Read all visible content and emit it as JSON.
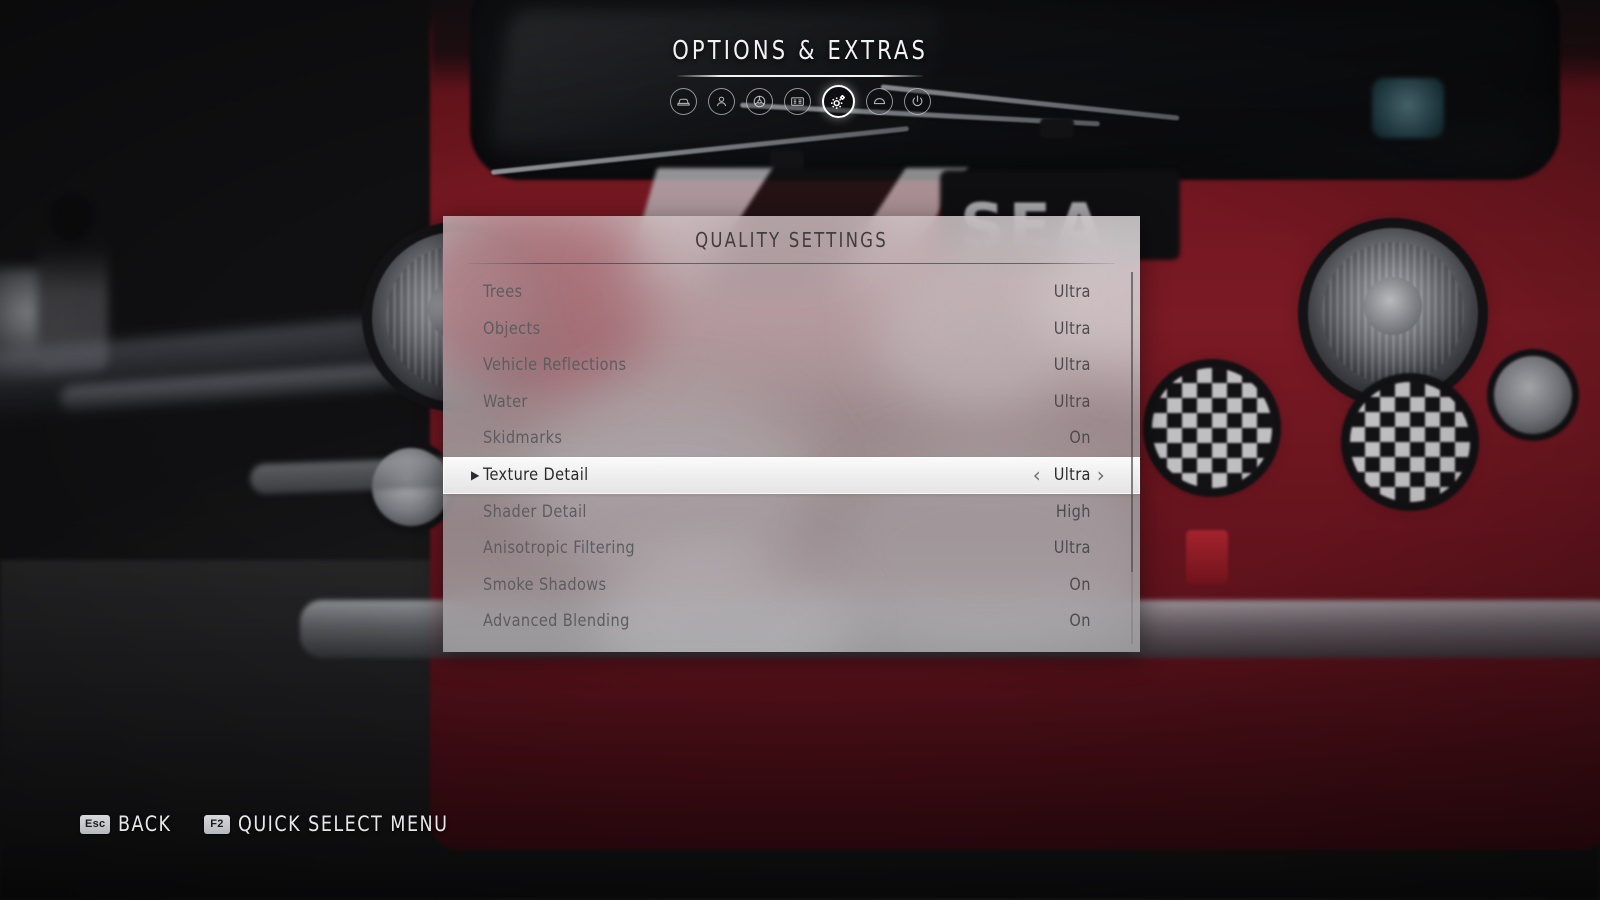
{
  "header": {
    "title": "OPTIONS & EXTRAS",
    "nav_icons": [
      {
        "name": "car-icon",
        "selected": false
      },
      {
        "name": "driver-icon",
        "selected": false
      },
      {
        "name": "wheel-icon",
        "selected": false
      },
      {
        "name": "display-icon",
        "selected": false
      },
      {
        "name": "gear-icon",
        "selected": true
      },
      {
        "name": "audio-icon",
        "selected": false
      },
      {
        "name": "power-icon",
        "selected": false
      }
    ]
  },
  "panel": {
    "title": "QUALITY SETTINGS",
    "selected_index": 5,
    "left_chevron": "‹",
    "right_chevron": "›",
    "selection_marker": "▶",
    "rows": [
      {
        "label": "Trees",
        "value": "Ultra"
      },
      {
        "label": "Objects",
        "value": "Ultra"
      },
      {
        "label": "Vehicle Reflections",
        "value": "Ultra"
      },
      {
        "label": "Water",
        "value": "Ultra"
      },
      {
        "label": "Skidmarks",
        "value": "On"
      },
      {
        "label": "Texture Detail",
        "value": "Ultra"
      },
      {
        "label": "Shader Detail",
        "value": "High"
      },
      {
        "label": "Anisotropic Filtering",
        "value": "Ultra"
      },
      {
        "label": "Smoke Shadows",
        "value": "On"
      },
      {
        "label": "Advanced Blending",
        "value": "On"
      }
    ]
  },
  "footer": {
    "hints": [
      {
        "key": "Esc",
        "label": "BACK"
      },
      {
        "key": "F2",
        "label": "QUICK SELECT MENU"
      }
    ]
  },
  "colors": {
    "selected_row_bg": "#f2f2f2",
    "panel_bg": "#a8a8aa",
    "accent_white": "#ffffff",
    "car_red": "#9b1f2c",
    "text_dark": "#2b2b2d",
    "text_muted": "#5d5d60"
  },
  "scene": {
    "hood_text": "SEA"
  }
}
